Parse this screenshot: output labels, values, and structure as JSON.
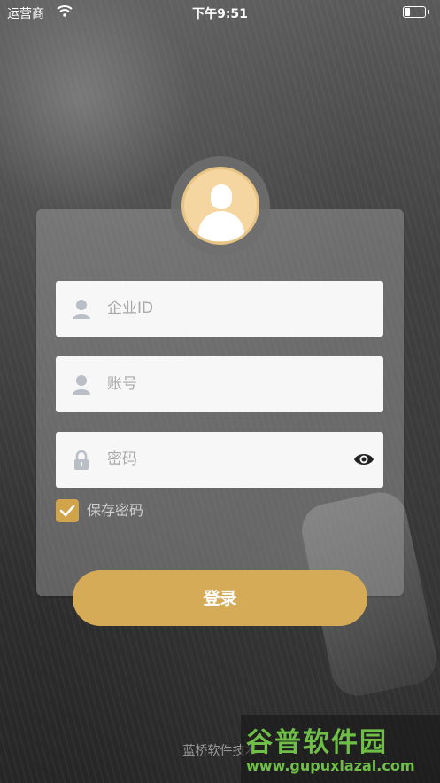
{
  "status_bar": {
    "carrier": "运营商",
    "time": "下午9:51"
  },
  "form": {
    "company_id_placeholder": "企业ID",
    "account_placeholder": "账号",
    "password_placeholder": "密码",
    "remember_label": "保存密码",
    "remember_checked": true,
    "login_label": "登录"
  },
  "footer": {
    "text": "蓝桥软件技术"
  },
  "watermark": {
    "brand": "谷普软件园",
    "url": "www.gupuxlazal.com"
  },
  "icons": [
    "wifi-icon",
    "battery-icon",
    "avatar-icon",
    "user-icon",
    "lock-icon",
    "eye-icon",
    "checkmark-icon"
  ],
  "colors": {
    "accent": "#d6ab57",
    "checkbox": "#d1a44c",
    "avatar_bg": "#f5d6a0",
    "watermark": "#6fbe47"
  }
}
